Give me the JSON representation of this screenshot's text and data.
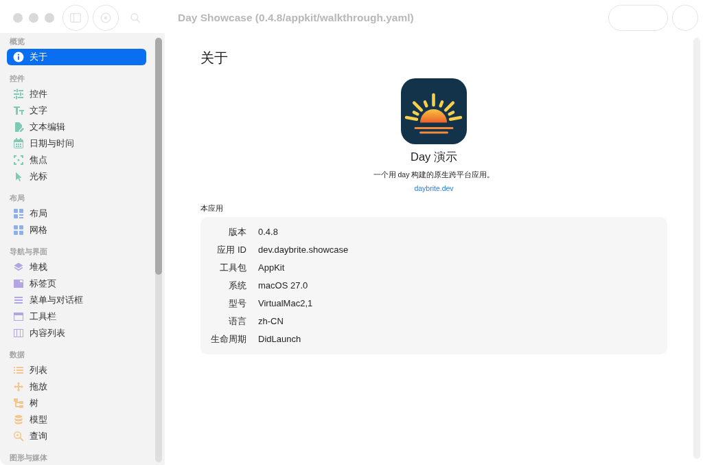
{
  "window": {
    "title": "Day Showcase (0.4.8/appkit/walkthrough.yaml)"
  },
  "sidebar": {
    "sections": [
      {
        "title": "概览",
        "items": [
          {
            "label": "关于",
            "selected": true
          }
        ]
      },
      {
        "title": "控件",
        "color": "#7fcab4",
        "items": [
          {
            "label": "控件",
            "selected": false
          },
          {
            "label": "文字",
            "selected": false
          },
          {
            "label": "文本编辑",
            "selected": false
          },
          {
            "label": "日期与时间",
            "selected": false
          },
          {
            "label": "焦点",
            "selected": false
          },
          {
            "label": "光标",
            "selected": false
          }
        ]
      },
      {
        "title": "布局",
        "color": "#8db0e8",
        "items": [
          {
            "label": "布局",
            "selected": false
          },
          {
            "label": "网格",
            "selected": false
          }
        ]
      },
      {
        "title": "导航与界面",
        "color": "#b3a4e2",
        "items": [
          {
            "label": "堆栈",
            "selected": false
          },
          {
            "label": "标签页",
            "selected": false
          },
          {
            "label": "菜单与对话框",
            "selected": false
          },
          {
            "label": "工具栏",
            "selected": false
          },
          {
            "label": "内容列表",
            "selected": false
          }
        ]
      },
      {
        "title": "数据",
        "color": "#f2c68e",
        "items": [
          {
            "label": "列表",
            "selected": false
          },
          {
            "label": "拖放",
            "selected": false
          },
          {
            "label": "树",
            "selected": false
          },
          {
            "label": "模型",
            "selected": false
          },
          {
            "label": "查询",
            "selected": false
          }
        ]
      },
      {
        "title": "图形与媒体"
      }
    ]
  },
  "page": {
    "heading": "关于",
    "app_name": "Day 演示",
    "tagline": "一个用 day 构建的原生跨平台应用。",
    "link": "daybrite.dev",
    "section_title": "本应用",
    "info_rows": [
      {
        "label": "版本",
        "value": "0.4.8"
      },
      {
        "label": "应用 ID",
        "value": "dev.daybrite.showcase"
      },
      {
        "label": "工具包",
        "value": "AppKit"
      },
      {
        "label": "系统",
        "value": "macOS 27.0"
      },
      {
        "label": "型号",
        "value": "VirtualMac2,1"
      },
      {
        "label": "语言",
        "value": "zh-CN"
      },
      {
        "label": "生命周期",
        "value": "DidLaunch"
      }
    ]
  }
}
